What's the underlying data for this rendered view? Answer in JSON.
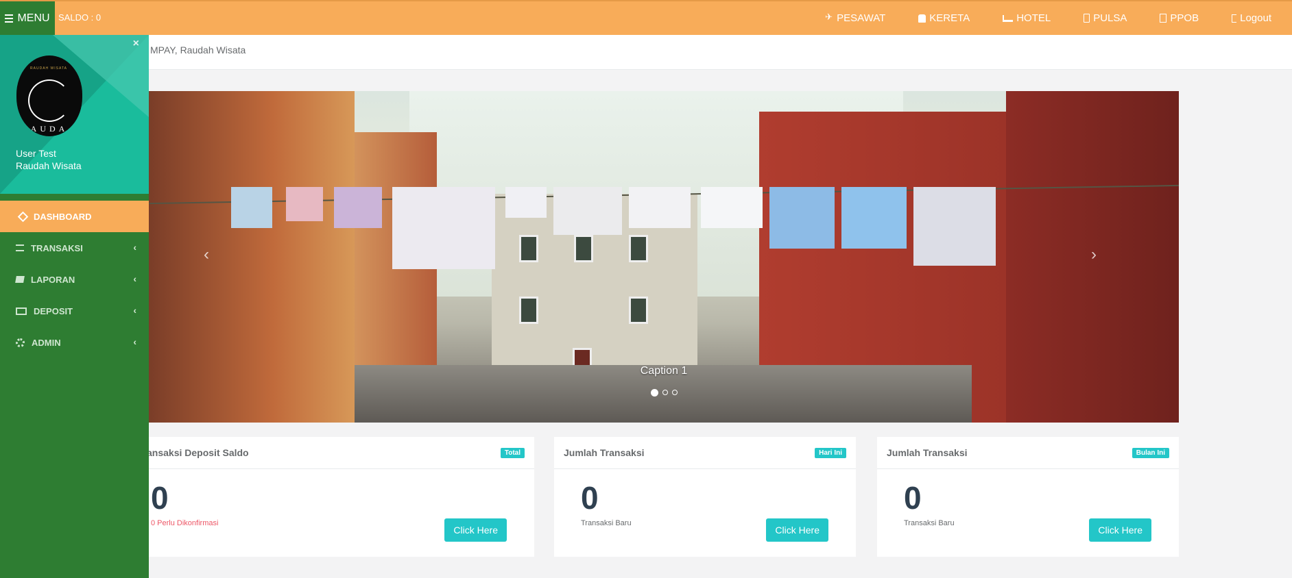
{
  "topbar": {
    "menu_label": "MENU",
    "saldo": "SALDO : 0",
    "nav": [
      {
        "label": "PESAWAT",
        "icon": "plane-icon"
      },
      {
        "label": "KERETA",
        "icon": "train-icon"
      },
      {
        "label": "HOTEL",
        "icon": "bed-icon"
      },
      {
        "label": "PULSA",
        "icon": "mobile-icon"
      },
      {
        "label": "PPOB",
        "icon": "document-icon"
      },
      {
        "label": "Logout",
        "icon": "logout-icon"
      }
    ],
    "accent": "#f8ac59"
  },
  "page": {
    "greeting": "MPAY, Raudah Wisata"
  },
  "carousel": {
    "caption": "Caption 1",
    "slides": 3,
    "active_slide": 1,
    "prev": "‹",
    "next": "›"
  },
  "sidebar": {
    "close": "×",
    "user_name": "User Test",
    "company": "Raudah Wisata",
    "logo_text": "AUDA",
    "logo_arc": "RAUDAH WISATA",
    "items": [
      {
        "label": "DASHBOARD",
        "icon": "diamond-icon",
        "active": true
      },
      {
        "label": "TRANSAKSI",
        "icon": "list-icon",
        "chevron": "‹"
      },
      {
        "label": "LAPORAN",
        "icon": "book-icon",
        "chevron": "‹"
      },
      {
        "label": "DEPOSIT",
        "icon": "credit-card-icon",
        "chevron": "‹"
      },
      {
        "label": "ADMIN",
        "icon": "gear-icon",
        "chevron": "‹"
      }
    ],
    "color": "#2e7d32"
  },
  "cards": [
    {
      "title": "ansaksi Deposit Saldo",
      "badge": "Total",
      "value": "0",
      "sub": "0 Perlu Dikonfirmasi",
      "button": "Click Here"
    },
    {
      "title": "Jumlah Transaksi",
      "badge": "Hari Ini",
      "value": "0",
      "sub": "Transaksi Baru",
      "button": "Click Here"
    },
    {
      "title": "Jumlah Transaksi",
      "badge": "Bulan Ini",
      "value": "0",
      "sub": "Transaksi Baru",
      "button": "Click Here"
    }
  ]
}
